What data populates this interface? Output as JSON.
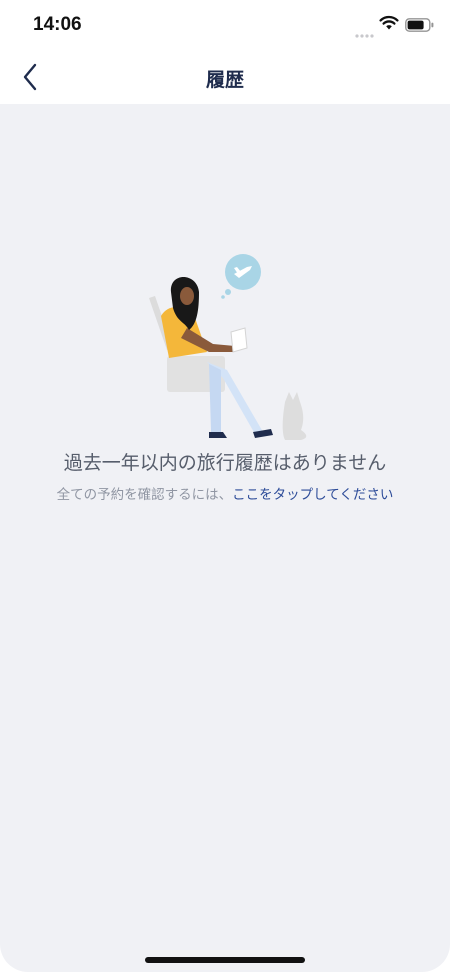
{
  "status_bar": {
    "time": "14:06",
    "icons": [
      "signal-dots-icon",
      "wifi-icon",
      "battery-icon"
    ]
  },
  "nav": {
    "back_icon": "chevron-left-icon",
    "title": "履歴"
  },
  "empty_state": {
    "illustration": "traveler-in-seat-illustration",
    "title": "過去一年以内の旅行履歴はありません",
    "subtitle_prefix": "全ての予約を確認するには、",
    "subtitle_link": "ここをタップしてください"
  },
  "colors": {
    "background": "#f0f1f5",
    "title_text": "#1f2c4d",
    "link": "#2d4c99",
    "bubble": "#a9d5e6",
    "shirt": "#f4b73a"
  }
}
